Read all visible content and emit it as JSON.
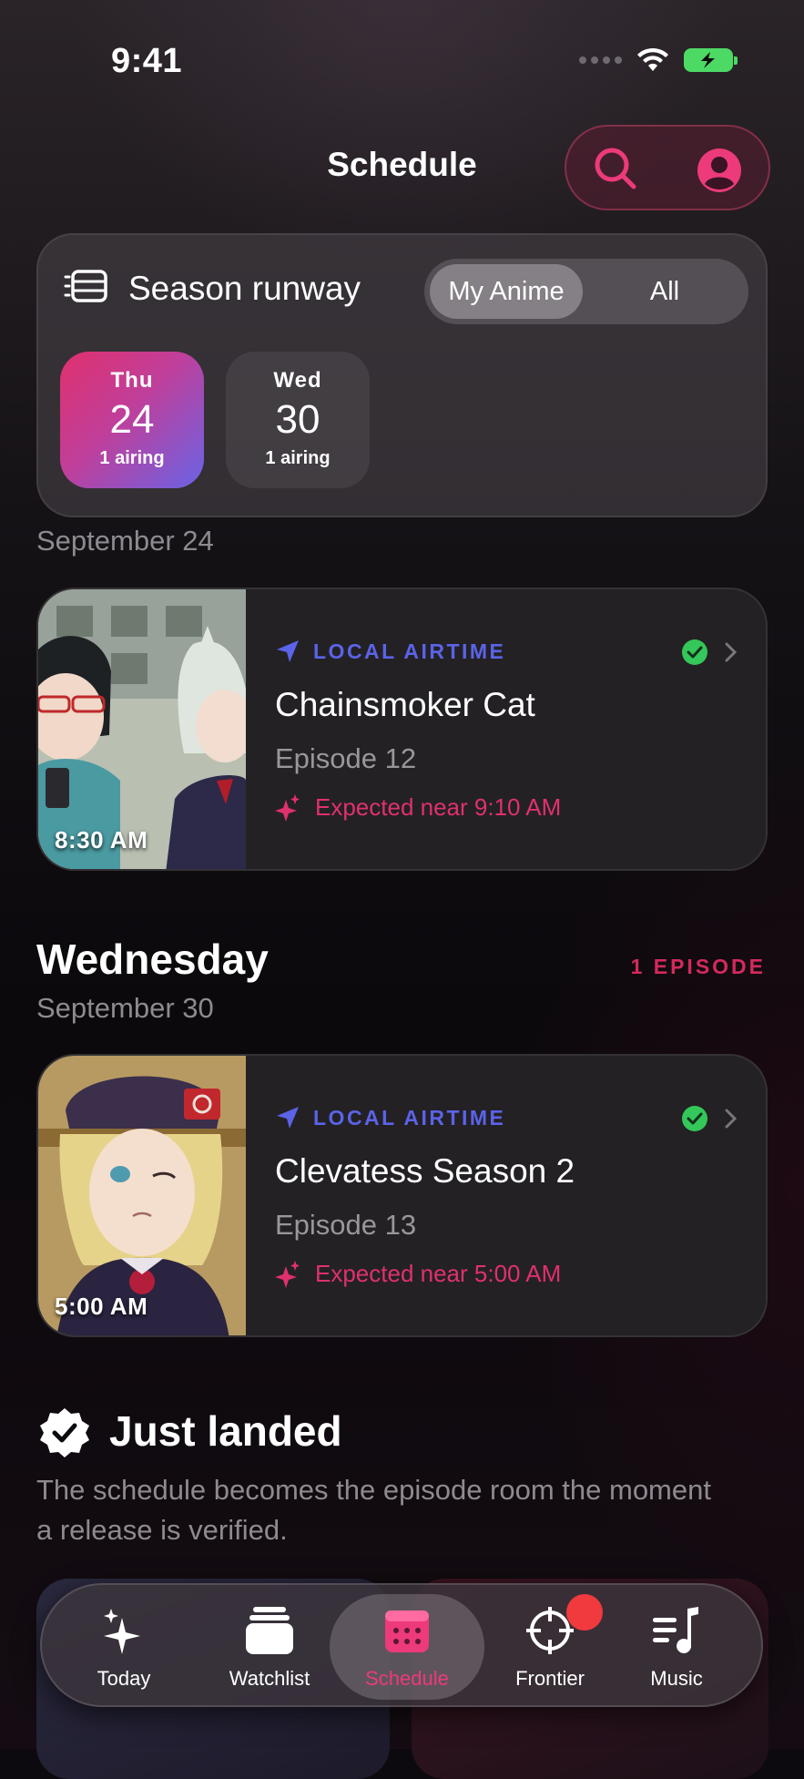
{
  "status_bar": {
    "time": "9:41"
  },
  "header": {
    "title": "Schedule"
  },
  "runway": {
    "title": "Season runway",
    "filter_options": [
      "My Anime",
      "All"
    ],
    "selected_filter": "My Anime",
    "days": [
      {
        "dow": "Thu",
        "date": "24",
        "count": "1 airing",
        "selected": true
      },
      {
        "dow": "Wed",
        "date": "30",
        "count": "1 airing",
        "selected": false
      }
    ]
  },
  "sections": [
    {
      "date_label": "September 24",
      "episode": {
        "tag": "LOCAL AIRTIME",
        "title": "Chainsmoker Cat",
        "episode": "Episode 12",
        "expected": "Expected near 9:10 AM",
        "air_time": "8:30 AM"
      }
    },
    {
      "day": "Wednesday",
      "date_label": "September 30",
      "count": "1 EPISODE",
      "episode": {
        "tag": "LOCAL AIRTIME",
        "title": "Clevatess Season 2",
        "episode": "Episode 13",
        "expected": "Expected near 5:00 AM",
        "air_time": "5:00 AM"
      }
    }
  ],
  "just_landed": {
    "title": "Just landed",
    "description": "The schedule becomes the episode room the moment a release is verified."
  },
  "tabs": {
    "today": "Today",
    "watchlist": "Watchlist",
    "schedule": "Schedule",
    "frontier": "Frontier",
    "music": "Music",
    "selected": "Schedule"
  },
  "colors": {
    "accent": "#ec3a7a",
    "airtime": "#5b63e8",
    "check": "#34c759",
    "badge": "#f03a3e"
  },
  "icons": [
    "wifi-icon",
    "battery-icon",
    "search-icon",
    "profile-icon",
    "runway-icon",
    "location-arrow-icon",
    "check-circle-icon",
    "chevron-right-icon",
    "sparkle-icon",
    "verified-badge-icon",
    "today-icon",
    "watchlist-icon",
    "schedule-icon",
    "frontier-icon",
    "music-icon"
  ]
}
